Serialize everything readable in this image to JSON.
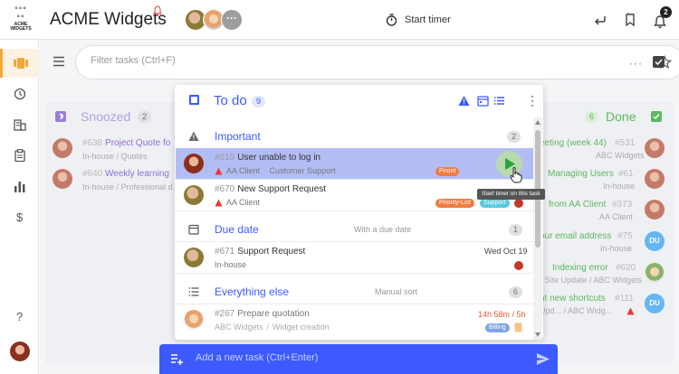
{
  "app": {
    "title": "ACME Widgets",
    "logo_text": "ACME WIDGETS",
    "more_label": "···",
    "start_timer_label": "Start timer",
    "notification_count": "2"
  },
  "filter": {
    "placeholder": "Filter tasks (Ctrl+F)",
    "more_label": "···"
  },
  "left_column": {
    "title": "Snoozed",
    "count": "2",
    "cards": [
      {
        "num": "#638",
        "title": "Project Quote fo",
        "sub1": "In-house",
        "sub2": "Quotes"
      },
      {
        "num": "#640",
        "title": "Weekly learning",
        "sub1": "In-house",
        "sub2": "Professional d"
      }
    ]
  },
  "right_column": {
    "title": "Done",
    "count": "6",
    "cards": [
      {
        "title": "eeting (week 44)",
        "num": "#531",
        "sub": "ABC Widgets"
      },
      {
        "title": "Managing Users",
        "num": "#61",
        "sub": "In-house"
      },
      {
        "title": "from AA Client",
        "num": "#373",
        "sub": "AA Client"
      },
      {
        "title": "our email address",
        "num": "#75",
        "sub": "In-house",
        "avatar": "DU"
      },
      {
        "title": "Indexing error",
        "num": "#620",
        "sub": "r Site Update",
        "sub_suffix": "ABC Widgets"
      },
      {
        "title": "nt new shortcuts",
        "num": "#111",
        "sub": "Upd...",
        "sub_suffix": "ABC Widg...",
        "avatar": "DU"
      }
    ]
  },
  "panel": {
    "title": "To do",
    "count": "9",
    "more_label": "⋮",
    "sections": [
      {
        "title": "Important",
        "count": "2",
        "tasks": [
          {
            "num": "#619",
            "title": "User unable to log in",
            "client": "AA Client",
            "category": "Customer Support",
            "chips": [
              "Priorit"
            ],
            "highlight": true
          },
          {
            "num": "#670",
            "title": "New Support Request",
            "client": "AA Client",
            "category": "",
            "chips": [
              "Priority-List",
              "Support"
            ]
          }
        ]
      },
      {
        "title": "Due date",
        "meta": "With a due date",
        "count": "1",
        "tasks": [
          {
            "num": "#671",
            "title": "Support Request",
            "client": "In-house",
            "due": "Wed Oct 19"
          }
        ]
      },
      {
        "title": "Everything else",
        "meta": "Manual sort",
        "count": "6",
        "tasks": [
          {
            "num": "#267",
            "title": "Prepare quotation",
            "client": "ABC Widgets",
            "category": "Widget creation",
            "time": "14h 58m / 5h",
            "chips": [
              "Billing"
            ]
          }
        ]
      }
    ]
  },
  "tooltip": "Start timer on this task",
  "add_task": {
    "placeholder": "Add a new task (Ctrl+Enter)"
  },
  "colors": {
    "accent": "#3d5afe",
    "highlight_row": "#b3bdf5",
    "priority_chip": "#f07b3f",
    "support_chip": "#5bc8dc",
    "snoozed_title": "#b89ee0",
    "done_title": "#5fb760",
    "warning": "#e53935"
  }
}
